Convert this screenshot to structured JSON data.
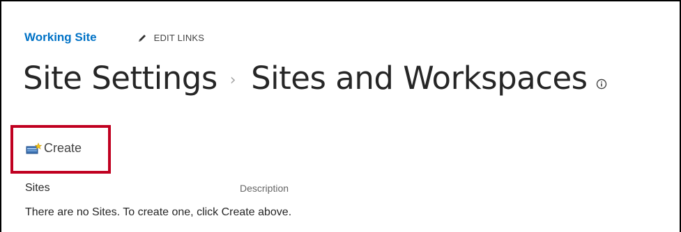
{
  "header": {
    "site_link": "Working Site",
    "edit_links_label": "EDIT LINKS"
  },
  "title": {
    "crumb_parent": "Site Settings",
    "separator": "›",
    "crumb_current": "Sites and Workspaces"
  },
  "toolbar": {
    "create_label": "Create",
    "highlight_color": "#c00020"
  },
  "list": {
    "columns": [
      "Sites",
      "Description"
    ],
    "empty_message": "There are no Sites. To create one, click Create above."
  },
  "icons": {
    "edit": "pencil-icon",
    "info": "info-icon",
    "create": "create-site-icon"
  },
  "colors": {
    "link": "#0072c6",
    "text": "#262626"
  }
}
